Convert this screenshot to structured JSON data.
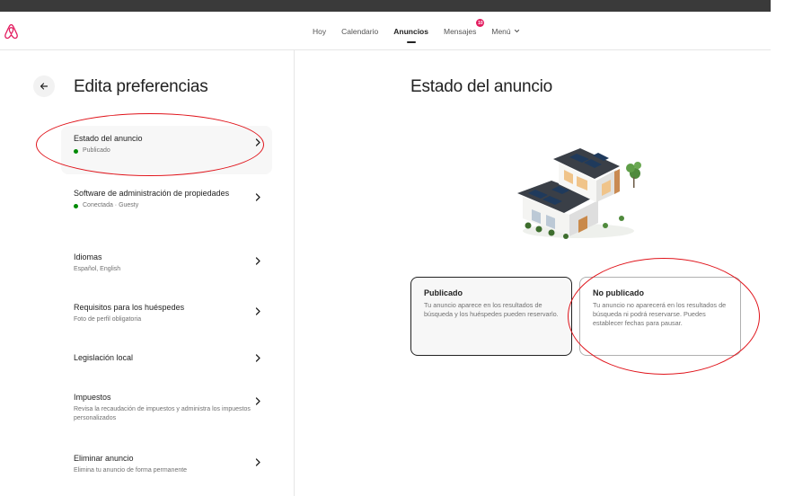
{
  "nav": {
    "hoy": "Hoy",
    "calendario": "Calendario",
    "anuncios": "Anuncios",
    "mensajes": "Mensajes",
    "mensajes_badge": "10",
    "menu": "Menú"
  },
  "left": {
    "title": "Edita preferencias",
    "items": [
      {
        "title": "Estado del anuncio",
        "subtitle": "Publicado"
      },
      {
        "title": "Software de administración de propiedades",
        "subtitle": "Conectada · Guesty"
      },
      {
        "title": "Idiomas",
        "subtitle": "Español, English"
      },
      {
        "title": "Requisitos para los huéspedes",
        "subtitle": "Foto de perfil obligatoria"
      },
      {
        "title": "Legislación local",
        "subtitle": ""
      },
      {
        "title": "Impuestos",
        "subtitle": "Revisa la recaudación de impuestos y administra los impuestos personalizados"
      },
      {
        "title": "Eliminar anuncio",
        "subtitle": "Elimina tu anuncio de forma permanente"
      }
    ]
  },
  "right": {
    "title": "Estado del anuncio",
    "cards": [
      {
        "title": "Publicado",
        "desc": "Tu anuncio aparece en los resultados de búsqueda y los huéspedes pueden reservarlo."
      },
      {
        "title": "No publicado",
        "desc": "Tu anuncio no aparecerá en los resultados de búsqueda ni podrá reservarse. Puedes establecer fechas para pausar."
      }
    ]
  },
  "colors": {
    "brand": "#e31c5f",
    "status_green": "#008a05",
    "annotation": "#e0141b"
  }
}
